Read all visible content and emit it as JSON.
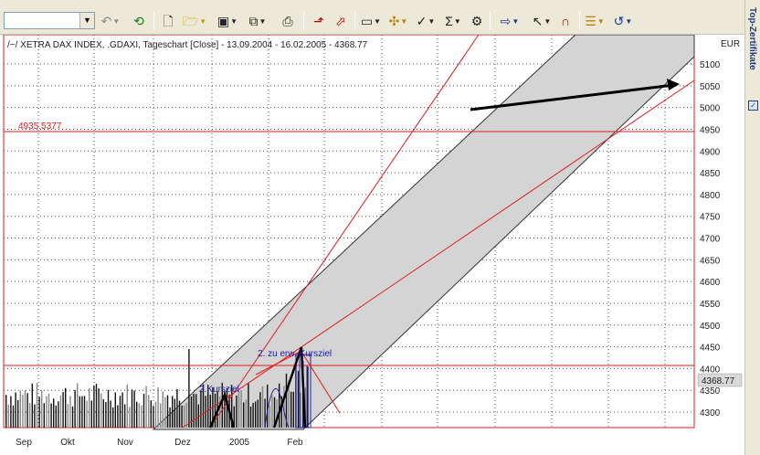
{
  "toolbar": {
    "symbol_value": "",
    "icons": [
      "undo-arrow-icon",
      "refresh-icon",
      "new-page-icon",
      "open-folder-icon",
      "save-disk-icon",
      "copy-icon",
      "print-icon",
      "drawing-tool-icon",
      "zoom-chart-icon",
      "window-icon",
      "indicator-icon",
      "analysis-icon",
      "sigma-icon",
      "settings-icon",
      "arrow-right-icon",
      "pointer-icon",
      "magnet-icon",
      "tag-icon",
      "reset-icon"
    ]
  },
  "side_panel": {
    "label": "Top-Zertifikate",
    "check": "✓"
  },
  "chart": {
    "title": "/~/ XETRA DAX INDEX, .GDAXI, Tageschart [Close] - 13.09.2004 - 16.02.2005 - 4368.77",
    "currency": "EUR",
    "last_price": "4368.77",
    "level_label": "4935.5377",
    "target_label_1": "2.Kursziel",
    "target_label_2": "2. zu erw. Kursziel",
    "colors": {
      "grid": "#555555",
      "accent": "#e31b1b",
      "channel": "#d4d4d4",
      "bars": "#111111",
      "blue": "#2020a8",
      "price_box": "#d9d9d9"
    }
  },
  "chart_data": {
    "type": "bar",
    "title": "/~/ XETRA DAX INDEX, .GDAXI, Tageschart [Close] - 13.09.2004 - 16.02.2005 - 4368.77",
    "ylim": [
      4270,
      5140
    ],
    "y_ticks": [
      5100,
      5050,
      5000,
      4950,
      4900,
      4850,
      4800,
      4750,
      4700,
      4650,
      4600,
      4550,
      4500,
      4450,
      4400,
      4350,
      4300
    ],
    "x_tick_labels": [
      "Sep",
      "Okt",
      "Nov",
      "Dez",
      "2005",
      "Feb"
    ],
    "y_tick_labels": [
      "5100",
      "5050",
      "5000",
      "4950",
      "4900",
      "4850",
      "4800",
      "4750",
      "4700",
      "4650",
      "4600",
      "4550",
      "4500",
      "4450",
      "4400",
      "4350",
      "4300"
    ],
    "grid": true,
    "horizontal_levels": [
      4935.54,
      4400
    ],
    "last_close": 4368.77
  }
}
